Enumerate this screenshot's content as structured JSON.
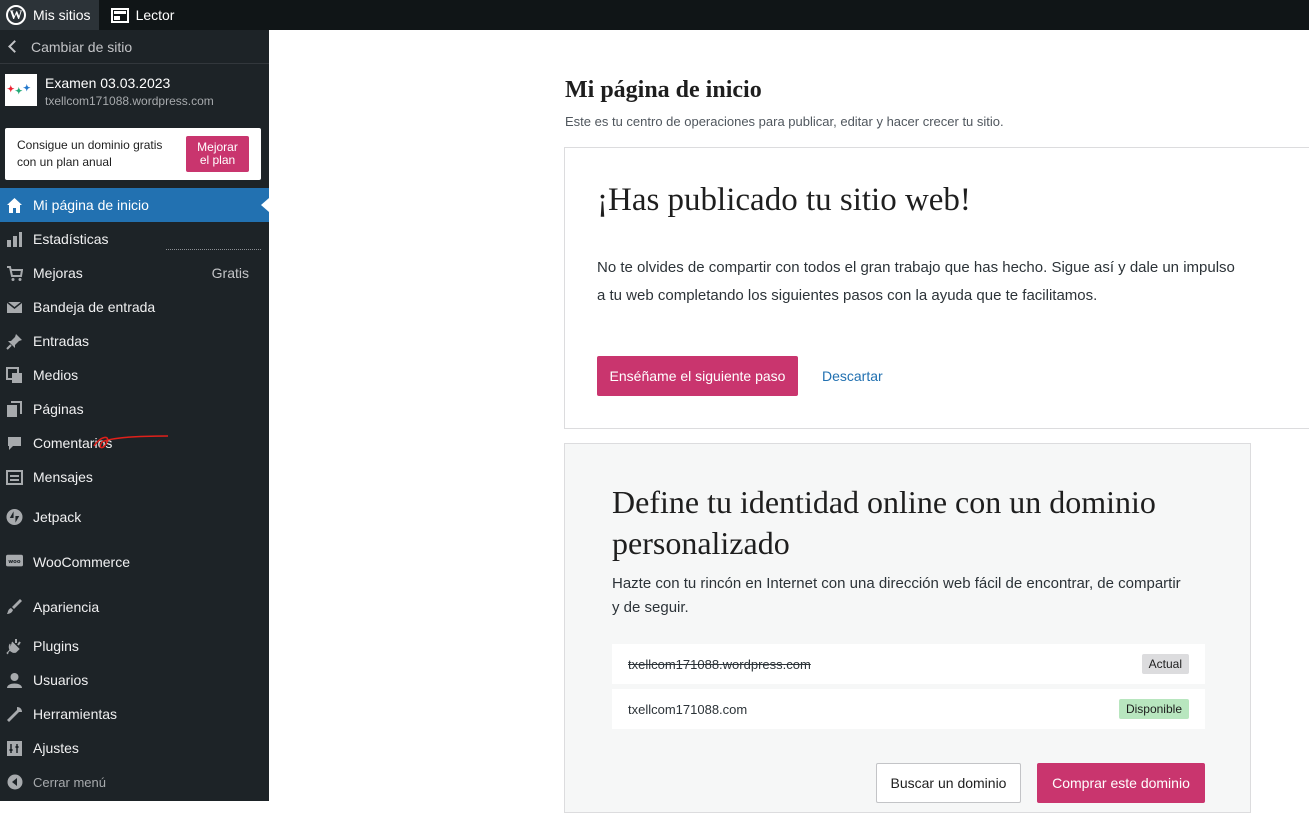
{
  "topbar": {
    "my_sites": "Mis sitios",
    "reader": "Lector"
  },
  "sidebar": {
    "switch_site": "Cambiar de sitio",
    "site": {
      "title": "Examen 03.03.2023",
      "url": "txellcom171088.wordpress.com"
    },
    "upgrade": {
      "text_line1": "Consigue un dominio gratis",
      "text_line2": "con un plan anual",
      "button": "Mejorar el plan"
    },
    "items": [
      {
        "label": "Mi página de inicio",
        "icon": "home-icon"
      },
      {
        "label": "Estadísticas",
        "icon": "stats-icon"
      },
      {
        "label": "Mejoras",
        "icon": "cart-icon",
        "badge": "Gratis"
      },
      {
        "label": "Bandeja de entrada",
        "icon": "mail-icon"
      },
      {
        "label": "Entradas",
        "icon": "pin-icon"
      },
      {
        "label": "Medios",
        "icon": "media-icon"
      },
      {
        "label": "Páginas",
        "icon": "pages-icon"
      },
      {
        "label": "Comentarios",
        "icon": "comment-icon"
      },
      {
        "label": "Mensajes",
        "icon": "feedback-icon"
      },
      {
        "label": "Jetpack",
        "icon": "jetpack-icon"
      },
      {
        "label": "WooCommerce",
        "icon": "woo-icon"
      },
      {
        "label": "Apariencia",
        "icon": "brush-icon"
      },
      {
        "label": "Plugins",
        "icon": "plugin-icon"
      },
      {
        "label": "Usuarios",
        "icon": "user-icon"
      },
      {
        "label": "Herramientas",
        "icon": "wrench-icon"
      },
      {
        "label": "Ajustes",
        "icon": "settings-icon"
      }
    ],
    "collapse": "Cerrar menú"
  },
  "main": {
    "title": "Mi página de inicio",
    "subtitle": "Este es tu centro de operaciones para publicar, editar y hacer crecer tu sitio.",
    "card1": {
      "heading": "¡Has publicado tu sitio web!",
      "body": "No te olvides de compartir con todos el gran trabajo que has hecho. Sigue así y dale un impulso a tu web completando los siguientes pasos con la ayuda que te facilitamos.",
      "primary": "Enséñame el siguiente paso",
      "dismiss": "Descartar"
    },
    "card2": {
      "heading": "Define tu identidad online con un dominio personalizado",
      "body": "Hazte con tu rincón en Internet con una dirección web fácil de encontrar, de compartir y de seguir.",
      "domains": [
        {
          "name": "txellcom171088.wordpress.com",
          "tag": "Actual"
        },
        {
          "name": "txellcom171088.com",
          "tag": "Disponible"
        }
      ],
      "search_button": "Buscar un dominio",
      "buy_button": "Comprar este dominio"
    }
  },
  "colors": {
    "accent_pink": "#c9356e",
    "active_blue": "#2271b1",
    "sidebar_bg": "#1d2327"
  }
}
